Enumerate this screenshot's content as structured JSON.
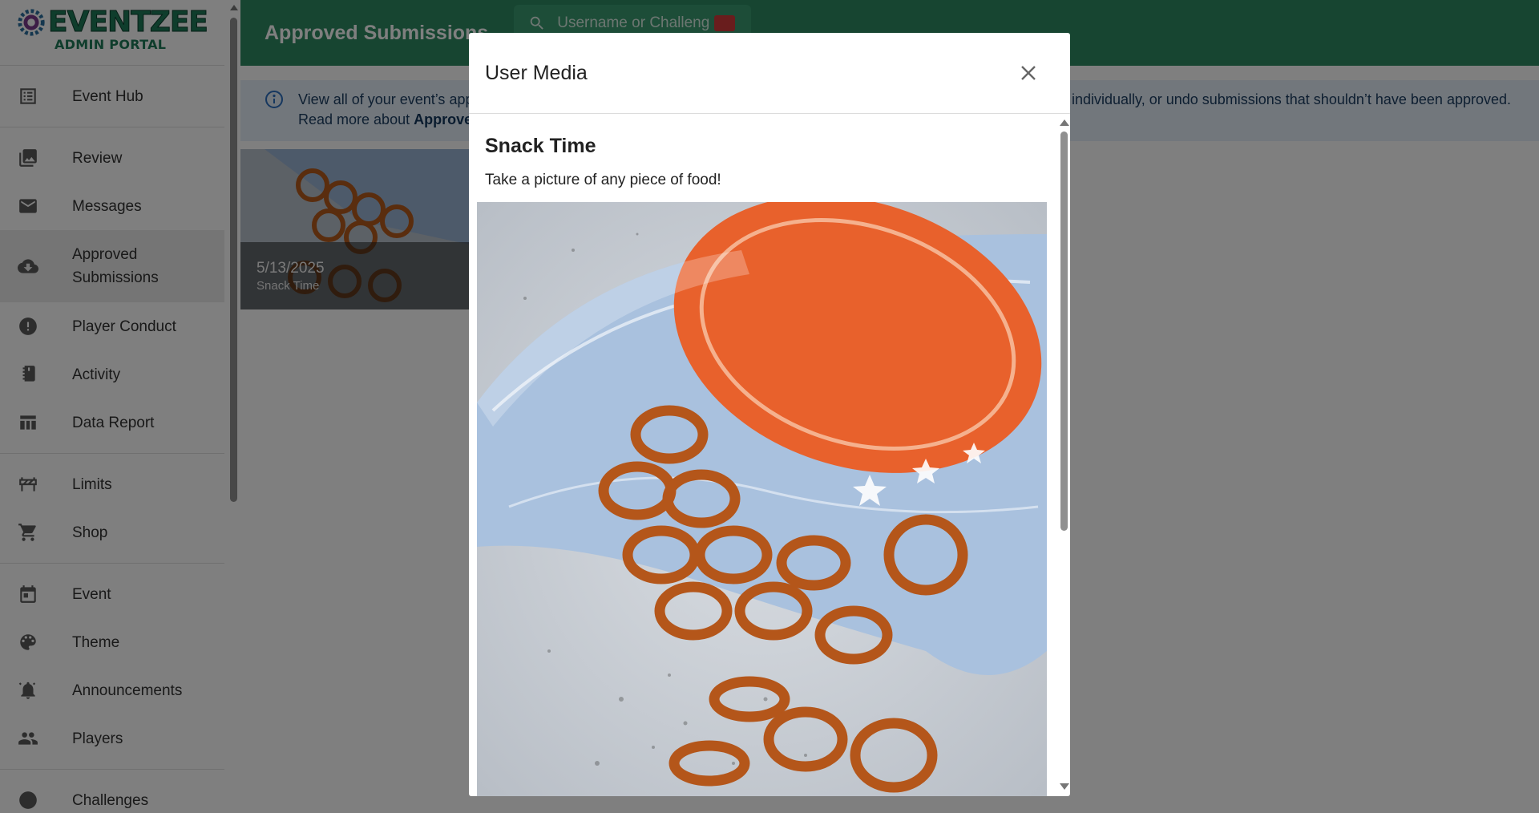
{
  "brand": {
    "title": "EVENTZEE",
    "subtitle": "ADMIN PORTAL"
  },
  "sidebar": {
    "groups": [
      [
        {
          "label": "Event Hub",
          "icon": "list-icon"
        }
      ],
      [
        {
          "label": "Review",
          "icon": "photo-library-icon"
        },
        {
          "label": "Messages",
          "icon": "mail-icon"
        },
        {
          "label": "Approved Submissions",
          "icon": "cloud-download-icon",
          "active": true
        },
        {
          "label": "Player Conduct",
          "icon": "alert-icon"
        },
        {
          "label": "Activity",
          "icon": "activity-book-icon"
        },
        {
          "label": "Data Report",
          "icon": "table-icon"
        }
      ],
      [
        {
          "label": "Limits",
          "icon": "roadblock-icon"
        },
        {
          "label": "Shop",
          "icon": "cart-icon"
        }
      ],
      [
        {
          "label": "Event",
          "icon": "calendar-icon"
        },
        {
          "label": "Theme",
          "icon": "palette-icon"
        },
        {
          "label": "Announcements",
          "icon": "bell-icon"
        },
        {
          "label": "Players",
          "icon": "people-icon"
        }
      ],
      [
        {
          "label": "Challenges",
          "icon": "challenge-icon"
        }
      ]
    ]
  },
  "header": {
    "title": "Approved Submissions",
    "search_placeholder": "Username or Challenge"
  },
  "info": {
    "line1_start": "View all of your event’s app",
    "line1_end": "individually, or undo submissions that shouldn’t have been approved.",
    "line2_prefix": "Read more about ",
    "line2_link": "Approved"
  },
  "card": {
    "date": "5/13/2025",
    "challenge": "Snack Time"
  },
  "modal": {
    "title": "User Media",
    "challenge_title": "Snack Time",
    "challenge_description": "Take a picture of any piece of food!",
    "media_alt": "Bag of salted pretzels spilling onto a countertop"
  },
  "colors": {
    "header_green": "#2e8b63",
    "brand_green": "#1f7a58",
    "info_bg": "#e4eef8"
  }
}
